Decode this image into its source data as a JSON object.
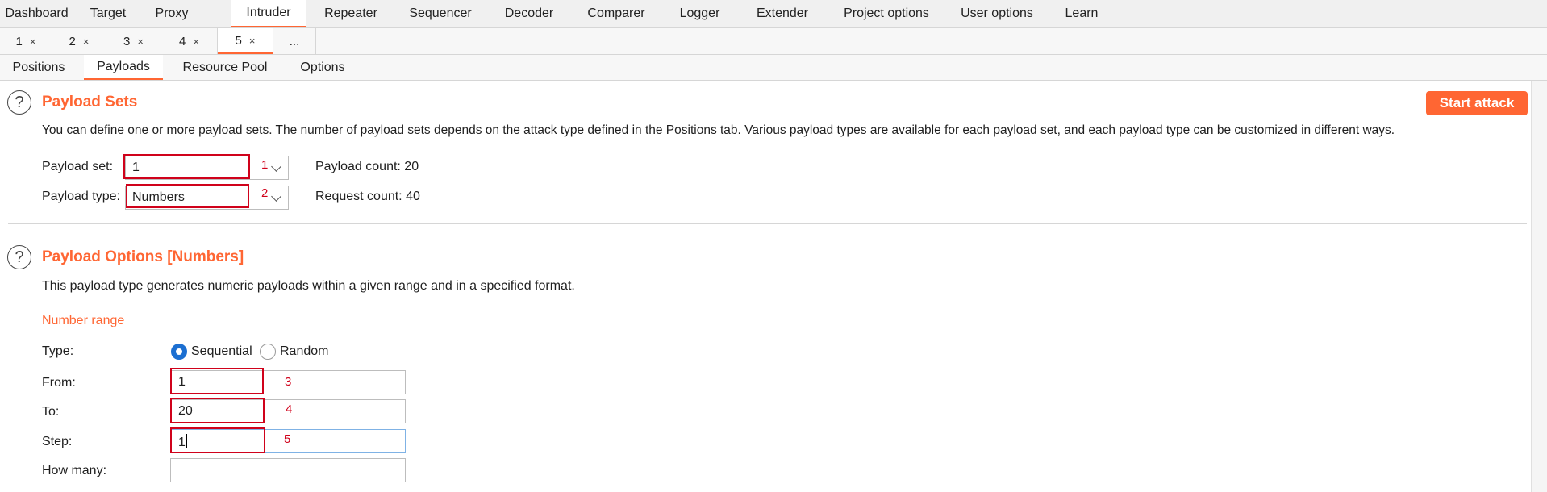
{
  "main_tabs": [
    {
      "label": "Dashboard"
    },
    {
      "label": "Target"
    },
    {
      "label": "Proxy"
    },
    {
      "label": "Intruder"
    },
    {
      "label": "Repeater"
    },
    {
      "label": "Sequencer"
    },
    {
      "label": "Decoder"
    },
    {
      "label": "Comparer"
    },
    {
      "label": "Logger"
    },
    {
      "label": "Extender"
    },
    {
      "label": "Project options"
    },
    {
      "label": "User options"
    },
    {
      "label": "Learn"
    }
  ],
  "attack_tabs": [
    {
      "label": "1",
      "close": "×"
    },
    {
      "label": "2",
      "close": "×"
    },
    {
      "label": "3",
      "close": "×"
    },
    {
      "label": "4",
      "close": "×"
    },
    {
      "label": "5",
      "close": "×"
    }
  ],
  "attack_tab_more": "...",
  "sub_tabs": [
    {
      "label": "Positions"
    },
    {
      "label": "Payloads"
    },
    {
      "label": "Resource Pool"
    },
    {
      "label": "Options"
    }
  ],
  "help_glyph": "?",
  "payload_sets": {
    "title": "Payload Sets",
    "description": "You can define one or more payload sets. The number of payload sets depends on the attack type defined in the Positions tab. Various payload types are available for each payload set, and each payload type can be customized in different ways.",
    "start_attack": "Start attack",
    "set_label": "Payload set:",
    "set_value": "1",
    "type_label": "Payload type:",
    "type_value": "Numbers",
    "payload_count": "Payload count: 20",
    "request_count": "Request count: 40"
  },
  "payload_options": {
    "title": "Payload Options [Numbers]",
    "description": "This payload type generates numeric payloads within a given range and in a specified format.",
    "number_range": "Number range",
    "type_label": "Type:",
    "sequential": "Sequential",
    "random": "Random",
    "selected_type": "Sequential",
    "from_label": "From:",
    "from_value": "1",
    "to_label": "To:",
    "to_value": "20",
    "step_label": "Step:",
    "step_value": "1",
    "how_many_label": "How many:",
    "how_many_value": ""
  },
  "annotations": [
    "1",
    "2",
    "3",
    "4",
    "5"
  ],
  "colors": {
    "accent": "#ff6633",
    "annotation_red": "#d0021b",
    "radio_blue": "#1c6fd1"
  }
}
